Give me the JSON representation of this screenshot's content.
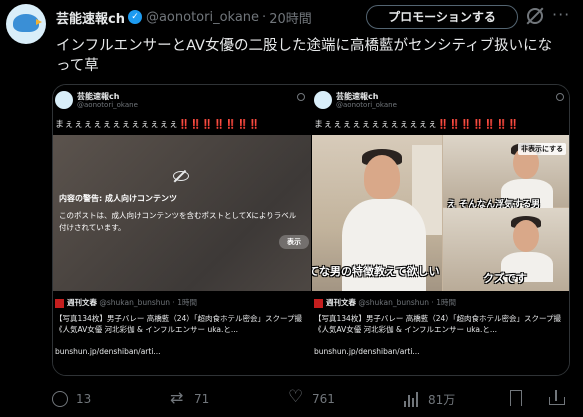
{
  "post": {
    "author_name": "芸能速報ch",
    "handle": "@aonotori_okane",
    "separator": "·",
    "time": "20時間",
    "promote_label": "プロモーションする",
    "more_label": "···",
    "text": "インフルエンサーとAV女優の二股した途端に高橋藍がセンシティブ扱いになって草"
  },
  "media_left": {
    "name": "芸能速報ch",
    "handle": "@aonotori_okane",
    "exclaim": "まぇぇぇぇぇぇぇぇぇぇぇぇ",
    "exclaim_marks": "‼️‼️‼️‼️‼️‼️‼️",
    "warning_title": "内容の警告: 成人向けコンテンツ",
    "warning_body": "このポストは、成人向けコンテンツを含むポストとしてXによりラベル付けされています。",
    "show_label": "表示",
    "source_name": "週刊文春",
    "source_handle": "@shukan_bunshun · 1時間",
    "article": "【写真134枚】男子バレー 高橋藍（24）「超肉食ホテル密会」スクープ撮《人気AV女優 河北彩伽 & インフルエンサー uka.と...",
    "link": "bunshun.jp/denshiban/arti..."
  },
  "media_right": {
    "name": "芸能速報ch",
    "handle": "@aonotori_okane",
    "exclaim": "まぇぇぇぇぇぇぇぇぇぇぇぇ",
    "exclaim_marks": "‼️‼️‼️‼️‼️‼️‼️",
    "cap_hide": "非表示にする",
    "cap_mid": "え そんなん浮気する男",
    "cap_bottom": "てな男の特徴教えて欲しい",
    "cap_kuzu": "クズです",
    "source_name": "週刊文春",
    "source_handle": "@shukan_bunshun · 1時間",
    "article": "【写真134枚】男子バレー 高橋藍（24）「超肉食ホテル密会」スクープ撮《人気AV女優 河北彩伽 & インフルエンサー uka.と...",
    "link": "bunshun.jp/denshiban/arti..."
  },
  "actions": {
    "replies": "13",
    "reposts": "71",
    "likes": "761",
    "views": "81万"
  },
  "colors": {
    "accent": "#1d9bf0",
    "background": "#000000",
    "text": "#e7e9ea",
    "muted": "#71767b"
  }
}
